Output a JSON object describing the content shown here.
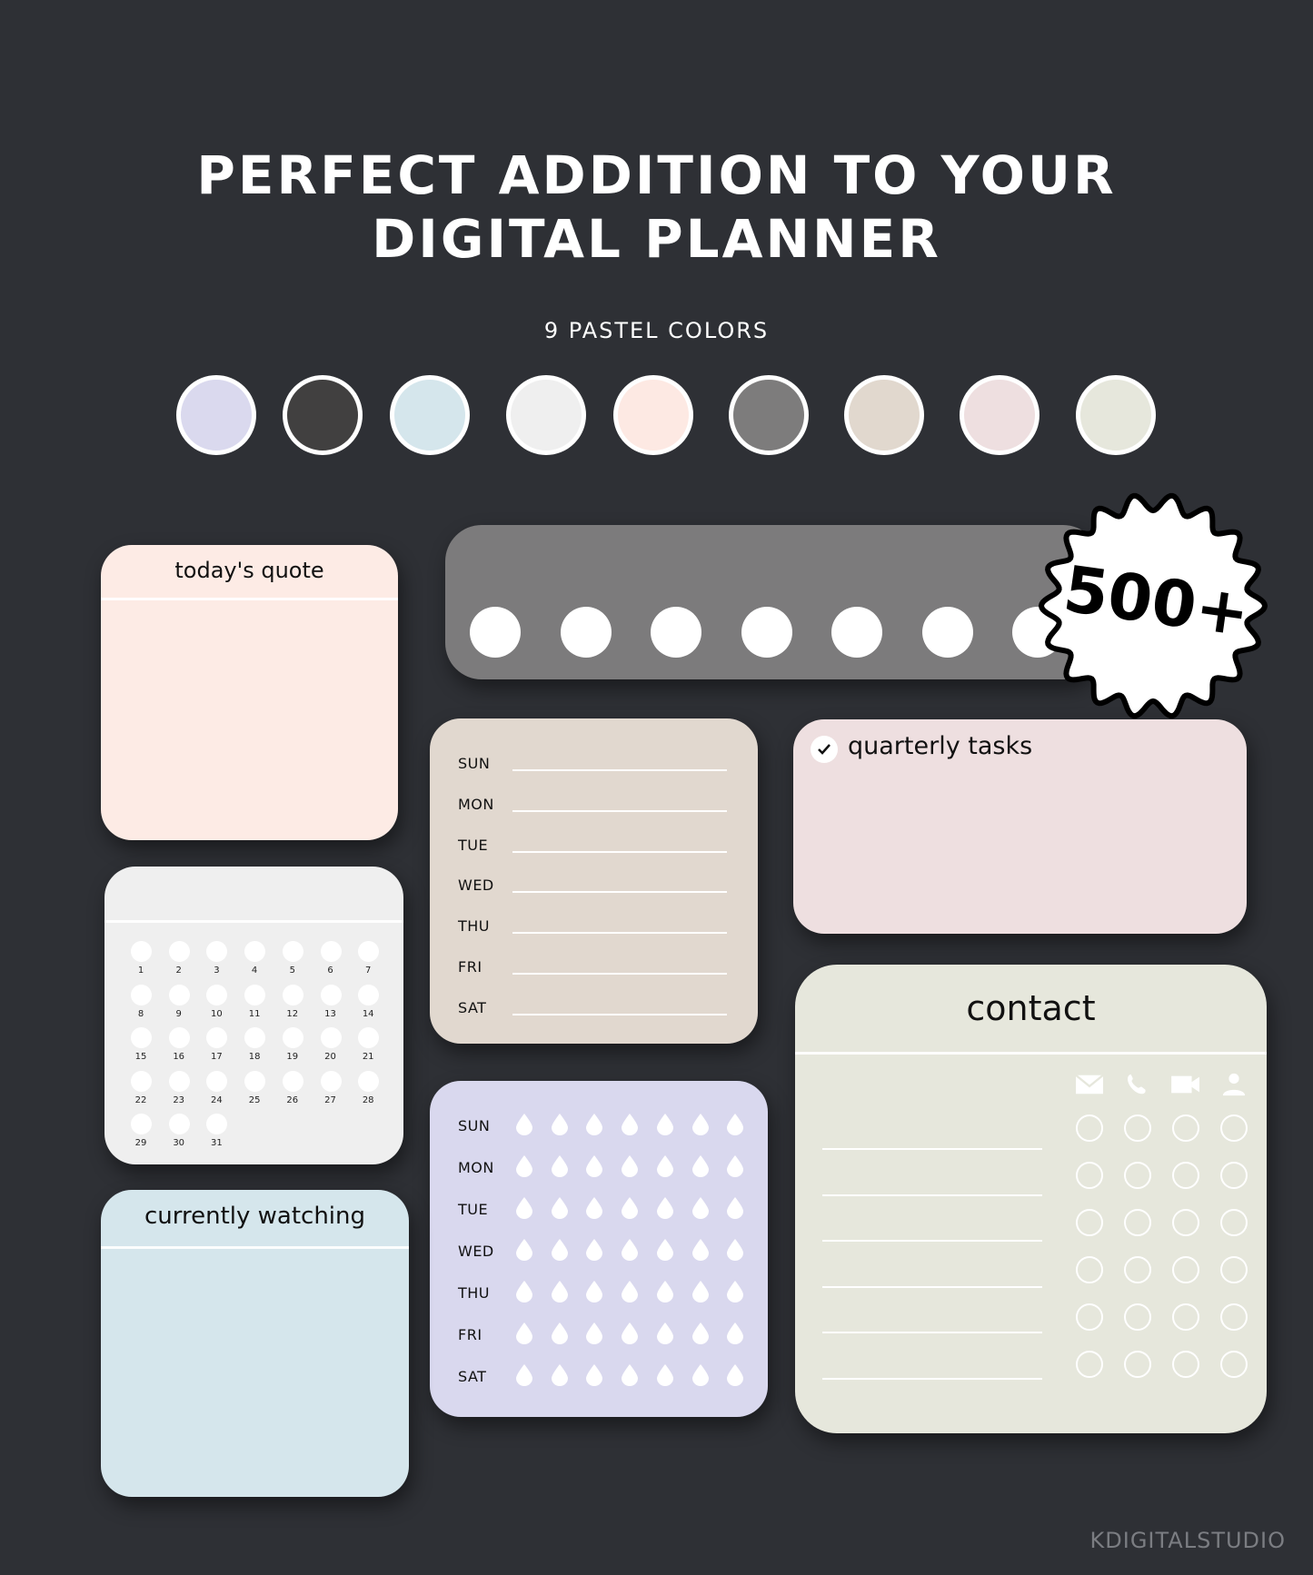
{
  "header": {
    "title_line1": "PERFECT ADDITION TO YOUR",
    "title_line2": "DIGITAL PLANNER",
    "subtitle": "9 PASTEL COLORS"
  },
  "palette": {
    "colors": [
      "#dad9ee",
      "#414040",
      "#d5e6ec",
      "#efefef",
      "#fde9e3",
      "#7d7c7c",
      "#e1d8ce",
      "#eedfe0",
      "#e6e7dc"
    ]
  },
  "badge": {
    "label": "500+"
  },
  "widgets": {
    "quote": {
      "title": "today's quote",
      "color": "#fdebe5"
    },
    "tracker_bar": {
      "color": "#7c7b7c",
      "dot_count": 7
    },
    "calendar": {
      "color": "#efefef",
      "days": [
        "1",
        "2",
        "3",
        "4",
        "5",
        "6",
        "7",
        "8",
        "9",
        "10",
        "11",
        "12",
        "13",
        "14",
        "15",
        "16",
        "17",
        "18",
        "19",
        "20",
        "21",
        "22",
        "23",
        "24",
        "25",
        "26",
        "27",
        "28",
        "29",
        "30",
        "31"
      ]
    },
    "weekly": {
      "color": "#e1d8cf",
      "days": [
        "SUN",
        "MON",
        "TUE",
        "WED",
        "THU",
        "FRI",
        "SAT"
      ]
    },
    "quarterly": {
      "title": "quarterly tasks",
      "color": "#eedfe0"
    },
    "water": {
      "color": "#d9d8ee",
      "days": [
        "SUN",
        "MON",
        "TUE",
        "WED",
        "THU",
        "FRI",
        "SAT"
      ],
      "drops_per_day": 7
    },
    "watching": {
      "title": "currently watching",
      "color": "#d5e6ec"
    },
    "contact": {
      "title": "contact",
      "color": "#e6e7dc",
      "icons": [
        "mail-icon",
        "phone-icon",
        "video-icon",
        "person-icon"
      ],
      "rows": 6
    }
  },
  "footer": {
    "brand": "KDIGITALSTUDIO"
  }
}
